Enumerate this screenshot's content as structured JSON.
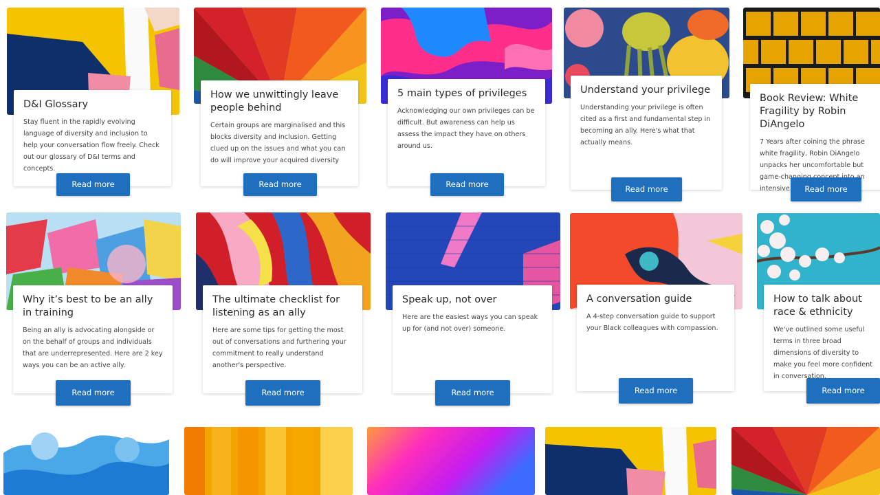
{
  "colors": {
    "button": "#1f6fbf",
    "button_text": "#ffffff",
    "card_bg": "#ffffff",
    "page_bg": "#ffffff"
  },
  "cards": [
    {
      "title": "D&I Glossary",
      "description": "Stay fluent in the rapidly evolving language of diversity and inclusion to help your conversation flow freely. Check out our glossary of D&I terms and concepts.",
      "button": "Read more",
      "image": "yellow-blue-geometric-mural"
    },
    {
      "title": "How we unwittingly leave people behind",
      "description": "Certain groups are marginalised and this blocks diversity and inclusion. Getting clued up on the issues and what you can do will improve your acquired diversity",
      "button": "Read more",
      "image": "rainbow-umbrella"
    },
    {
      "title": "5 main types of privileges",
      "description": "Acknowledging our own privileges can be difficult. But awareness can help us assess the impact they have on others around us.",
      "button": "Read more",
      "image": "pink-purple-paint"
    },
    {
      "title": "Understand your privilege",
      "description": "Understanding your privilege is often cited as a first and fundamental step in becoming an ally. Here's what that actually means.",
      "button": "Read more",
      "image": "jellyfish-mural"
    },
    {
      "title": "Book Review: White Fragility by Robin DiAngelo",
      "description": "7 Years after coining the phrase white fragility, Robin DiAngelo unpacks her uncomfortable but game-changing concept into an intensive personal workshop.",
      "button": "Read more",
      "image": "yellow-tiles"
    },
    {
      "title": "Why it’s best to be an ally in training",
      "description": "Being an ally is advocating alongside or on the behalf of groups and individuals that are underrepresented. Here are 2 key ways you can be an active ally.",
      "button": "Read more",
      "image": "colorful-flags"
    },
    {
      "title": "The ultimate checklist for listening as an ally",
      "description": "Here are some tips for getting the most out of conversations and furthering your commitment to really understand another's perspective.",
      "button": "Read more",
      "image": "colorful-wall-mural"
    },
    {
      "title": "Speak up, not over",
      "description": "Here are the easiest ways you can speak up for (and not over) someone.",
      "button": "Read more",
      "image": "blue-brick-wall"
    },
    {
      "title": "A conversation guide",
      "description": "A 4-step conversation guide to support your Black colleagues with compassion.",
      "button": "Read more",
      "image": "orange-bird-mural"
    },
    {
      "title": "How to talk about race & ethnicity",
      "description": "We've outlined some useful terms in three broad dimensions of diversity to make you feel more confident in conversation.",
      "button": "Read more",
      "image": "cherry-blossom-sky"
    },
    {
      "image": "blue-ink-smoke"
    },
    {
      "image": "orange-yellow-panels"
    },
    {
      "image": "pink-blue-gradient"
    },
    {
      "image": "yellow-blue-geometric-mural"
    },
    {
      "image": "rainbow-umbrella"
    }
  ]
}
